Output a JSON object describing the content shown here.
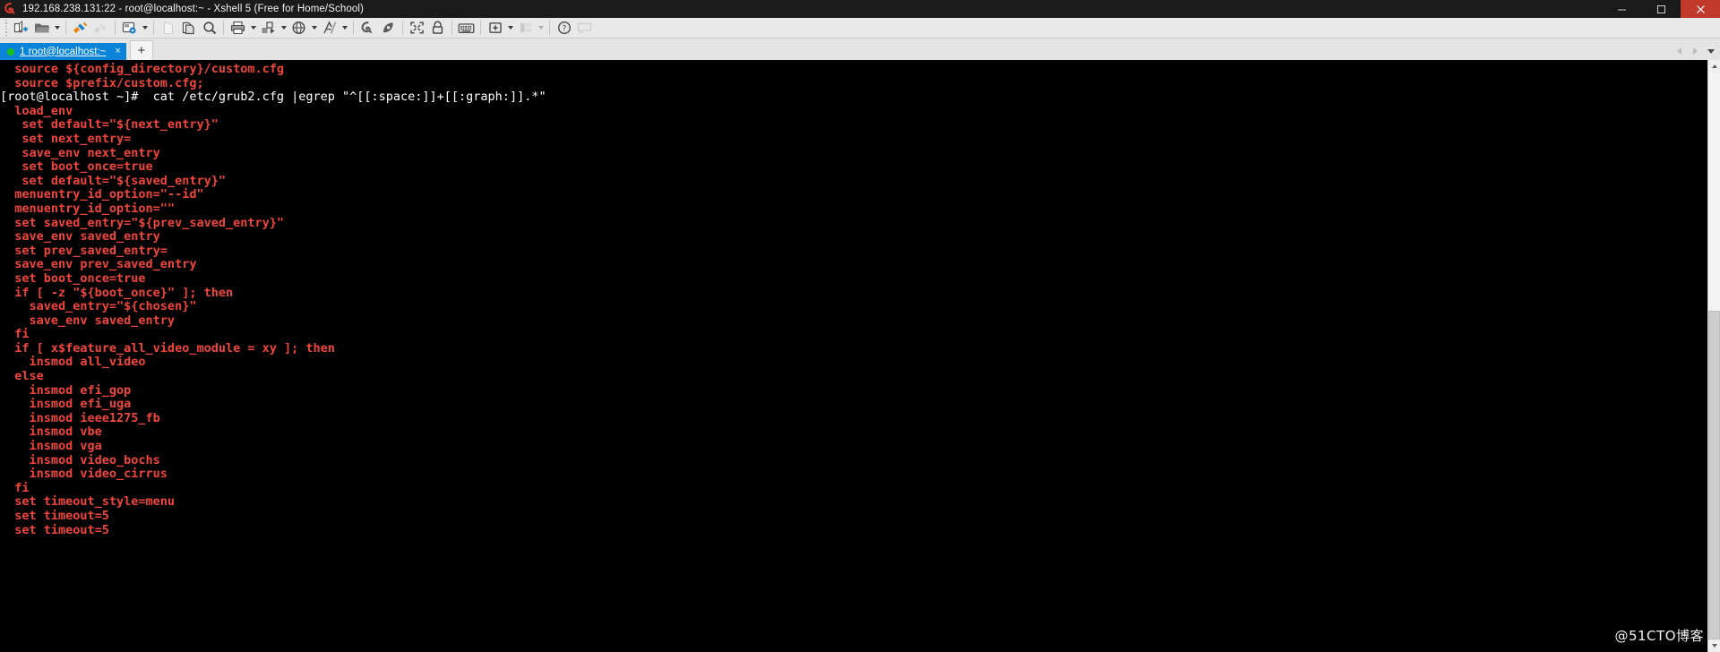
{
  "window": {
    "title": "192.168.238.131:22 - root@localhost:~ - Xshell 5 (Free for Home/School)",
    "app_icon": "xshell-logo-icon",
    "minimize_label": "Minimize",
    "maximize_label": "Restore",
    "close_label": "Close",
    "close_color": "#c0392b",
    "titlebar_color": "#1a1a1a"
  },
  "toolbar": {
    "items": [
      {
        "name": "new-session-icon",
        "label": "New Session",
        "arrow": false,
        "enabled": true
      },
      {
        "name": "open-folder-icon",
        "label": "Open",
        "arrow": true,
        "enabled": true
      },
      {
        "name": "connect-icon",
        "label": "Connect",
        "arrow": false,
        "enabled": true
      },
      {
        "name": "disconnect-icon",
        "label": "Disconnect",
        "arrow": false,
        "enabled": false
      },
      {
        "name": "session-properties-icon",
        "label": "Properties",
        "arrow": true,
        "enabled": true
      },
      {
        "name": "copy-icon",
        "label": "Copy",
        "arrow": false,
        "enabled": false
      },
      {
        "name": "paste-icon",
        "label": "Paste",
        "arrow": false,
        "enabled": true
      },
      {
        "name": "find-icon",
        "label": "Find",
        "arrow": false,
        "enabled": true
      },
      {
        "name": "print-icon",
        "label": "Print",
        "arrow": true,
        "enabled": true
      },
      {
        "name": "file-transfer-icon",
        "label": "File Transfer",
        "arrow": true,
        "enabled": true
      },
      {
        "name": "globe-icon",
        "label": "Web Browser",
        "arrow": true,
        "enabled": true
      },
      {
        "name": "font-icon",
        "label": "Font",
        "arrow": true,
        "enabled": true
      },
      {
        "name": "xshell-icon",
        "label": "Xshell",
        "arrow": false,
        "enabled": true
      },
      {
        "name": "xftp-icon",
        "label": "Xftp",
        "arrow": false,
        "enabled": true
      },
      {
        "name": "fullscreen-icon",
        "label": "Full Screen",
        "arrow": false,
        "enabled": true
      },
      {
        "name": "lock-icon",
        "label": "Lock",
        "arrow": false,
        "enabled": true
      },
      {
        "name": "keyboard-icon",
        "label": "Compose Bar",
        "arrow": false,
        "enabled": true
      },
      {
        "name": "new-tab-icon",
        "label": "New Tab",
        "arrow": true,
        "enabled": true
      },
      {
        "name": "split-layout-icon",
        "label": "Arrange Layout",
        "arrow": true,
        "enabled": false
      },
      {
        "name": "help-icon",
        "label": "Help",
        "arrow": false,
        "enabled": true
      },
      {
        "name": "chat-balloon-icon",
        "label": "Chat",
        "arrow": false,
        "enabled": false
      }
    ]
  },
  "tabstrip": {
    "tabs": [
      {
        "label": "1 root@localhost:~",
        "status_dot_color": "#17c017",
        "active": true,
        "close_label": "×"
      }
    ],
    "new_tab_label": "+",
    "scroll_left_label": "Scroll tabs left",
    "scroll_right_label": "Scroll tabs right",
    "tab_list_label": "Tab list"
  },
  "terminal": {
    "background": "#000000",
    "foreground": "#ffffff",
    "match_color": "#f0453d",
    "prompt_text": "[root@localhost ~]#  cat /etc/grub2.cfg |egrep \"^[[:space:]]+[[:graph:]].*\"",
    "lines": [
      {
        "type": "match",
        "text": "  source ${config_directory}/custom.cfg"
      },
      {
        "type": "match",
        "text": "  source $prefix/custom.cfg;"
      },
      {
        "type": "prompt",
        "text": "[root@localhost ~]#  cat /etc/grub2.cfg |egrep \"^[[:space:]]+[[:graph:]].*\""
      },
      {
        "type": "match",
        "text": "  load_env"
      },
      {
        "type": "match",
        "text": "   set default=\"${next_entry}\""
      },
      {
        "type": "match",
        "text": "   set next_entry="
      },
      {
        "type": "match",
        "text": "   save_env next_entry"
      },
      {
        "type": "match",
        "text": "   set boot_once=true"
      },
      {
        "type": "match",
        "text": "   set default=\"${saved_entry}\""
      },
      {
        "type": "match",
        "text": "  menuentry_id_option=\"--id\""
      },
      {
        "type": "match",
        "text": "  menuentry_id_option=\"\""
      },
      {
        "type": "match",
        "text": "  set saved_entry=\"${prev_saved_entry}\""
      },
      {
        "type": "match",
        "text": "  save_env saved_entry"
      },
      {
        "type": "match",
        "text": "  set prev_saved_entry="
      },
      {
        "type": "match",
        "text": "  save_env prev_saved_entry"
      },
      {
        "type": "match",
        "text": "  set boot_once=true"
      },
      {
        "type": "match",
        "text": "  if [ -z \"${boot_once}\" ]; then"
      },
      {
        "type": "match",
        "text": "    saved_entry=\"${chosen}\""
      },
      {
        "type": "match",
        "text": "    save_env saved_entry"
      },
      {
        "type": "match",
        "text": "  fi"
      },
      {
        "type": "match",
        "text": "  if [ x$feature_all_video_module = xy ]; then"
      },
      {
        "type": "match",
        "text": "    insmod all_video"
      },
      {
        "type": "match",
        "text": "  else"
      },
      {
        "type": "match",
        "text": "    insmod efi_gop"
      },
      {
        "type": "match",
        "text": "    insmod efi_uga"
      },
      {
        "type": "match",
        "text": "    insmod ieee1275_fb"
      },
      {
        "type": "match",
        "text": "    insmod vbe"
      },
      {
        "type": "match",
        "text": "    insmod vga"
      },
      {
        "type": "match",
        "text": "    insmod video_bochs"
      },
      {
        "type": "match",
        "text": "    insmod video_cirrus"
      },
      {
        "type": "match",
        "text": "  fi"
      },
      {
        "type": "match",
        "text": "  set timeout_style=menu"
      },
      {
        "type": "match",
        "text": "  set timeout=5"
      },
      {
        "type": "match",
        "text": "  set timeout=5"
      }
    ]
  },
  "scrollbar": {
    "up_label": "Scroll up",
    "down_label": "Scroll down",
    "thumb_label": "Scroll thumb"
  },
  "watermark": {
    "text": "@51CTO博客"
  }
}
